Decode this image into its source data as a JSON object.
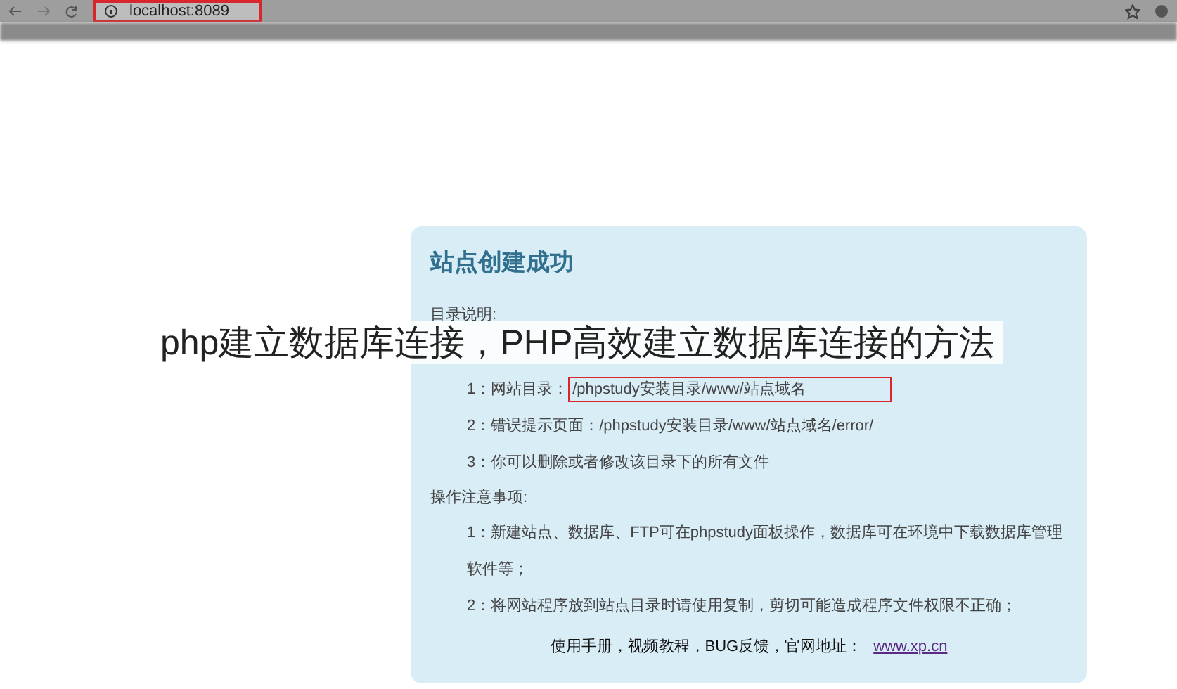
{
  "browser": {
    "url": "localhost:8089"
  },
  "card": {
    "title": "站点创建成功",
    "directory_heading": "目录说明:",
    "directory_items": [
      {
        "label": "1：网站目录：",
        "path": "/phpstudy安装目录/www/站点域名"
      },
      {
        "label": "2：错误提示页面：/phpstudy安装目录/www/站点域名/error/"
      },
      {
        "label": "3：你可以删除或者修改该目录下的所有文件"
      }
    ],
    "notes_heading": "操作注意事项:",
    "notes": [
      "1：新建站点、数据库、FTP可在phpstudy面板操作，数据库可在环境中下载数据库管理软件等；",
      "2：将网站程序放到站点目录时请使用复制，剪切可能造成程序文件权限不正确；"
    ],
    "footer": {
      "text": "使用手册，视频教程，BUG反馈，官网地址：",
      "link": "www.xp.cn"
    }
  },
  "banner": {
    "title": "php建立数据库连接，PHP高效建立数据库连接的方法"
  }
}
